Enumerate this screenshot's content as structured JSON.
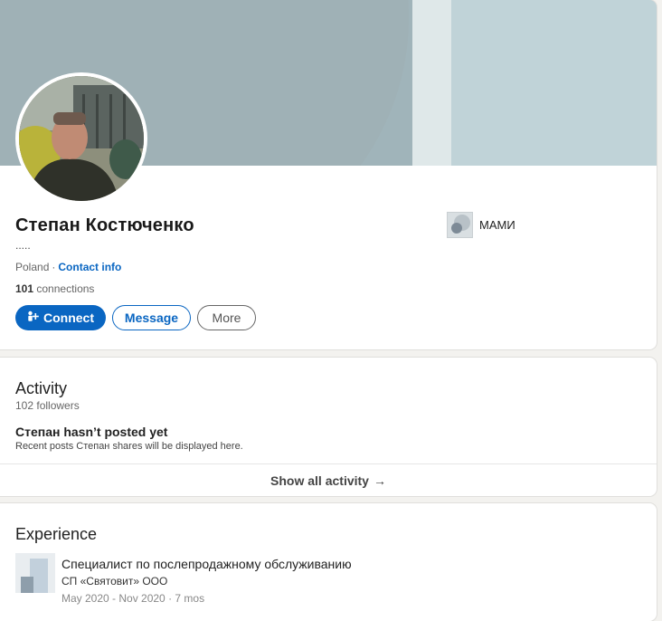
{
  "profile": {
    "name": "Степан Костюченко",
    "headline": ".....",
    "location": "Poland",
    "separator": "·",
    "contact_info_label": "Contact info",
    "connections_count": "101",
    "connections_label": "connections",
    "education_name": "МАМИ",
    "buttons": {
      "connect": "Connect",
      "message": "Message",
      "more": "More"
    },
    "icons": {
      "connect": "add-person-icon"
    }
  },
  "activity": {
    "title": "Activity",
    "followers": "102 followers",
    "empty_title": "Степан hasn’t posted yet",
    "empty_subtitle": "Recent posts Степан shares will be displayed here.",
    "show_all": "Show all activity",
    "arrow": "→"
  },
  "experience": {
    "title": "Experience",
    "items": [
      {
        "role": "Специалист по послепродажному обслуживанию",
        "company": "СП «Святовит» ООО",
        "dates": "May 2020 - Nov 2020 · 7 mos"
      }
    ]
  },
  "colors": {
    "accent": "#0a66c2",
    "background": "#f3f2ef",
    "cover": "#a0b4ba"
  }
}
